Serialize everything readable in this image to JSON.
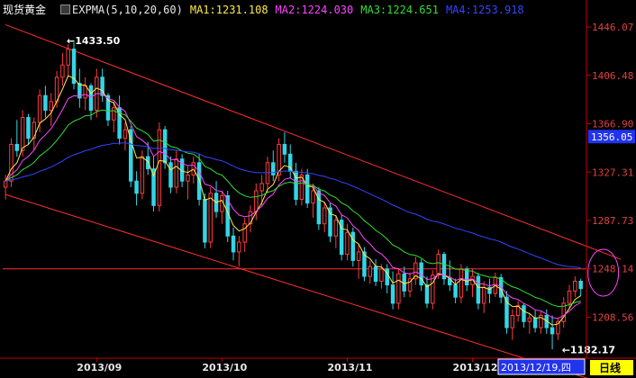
{
  "header": {
    "title": "现货黄金",
    "indicator": "EXPMA(5,10,20,60)",
    "ma1": "MA1:1231.108",
    "ma2": "MA2:1224.030",
    "ma3": "MA3:1224.651",
    "ma4": "MA4:1253.918"
  },
  "colors": {
    "up": "#ff3c3c",
    "down": "#33d6e6",
    "ma1": "#ffe94a",
    "ma2": "#ff44ff",
    "ma3": "#33dd33",
    "ma4": "#3344ff",
    "channel": "#ff3030",
    "axis": "#c00000",
    "price_label": "#e04040"
  },
  "chart_data": {
    "type": "candlestick",
    "ylim": [
      1175,
      1452
    ],
    "y_ticks": [
      "1446.07",
      "1406.48",
      "1366.90",
      "1327.31",
      "1287.73",
      "1248.14",
      "1208.56"
    ],
    "x_ticks": [
      {
        "label": "2013/09",
        "index": 16
      },
      {
        "label": "2013/10",
        "index": 38
      },
      {
        "label": "2013/11",
        "index": 60
      },
      {
        "label": "2013/12",
        "index": 82
      }
    ],
    "current_price": "1356.05",
    "horizontal_line": 1248.14,
    "high_annotation": {
      "label": "1433.50",
      "index": 12,
      "value": 1433.5
    },
    "low_annotation": {
      "label": "1182.17",
      "index": 98,
      "value": 1182.17
    },
    "cursor_date": "2013/12/19,四",
    "period_button": "日线",
    "channel_upper": [
      [
        0,
        1448
      ],
      [
        108,
        1256
      ]
    ],
    "channel_lower": [
      [
        0,
        1309
      ],
      [
        108,
        1150
      ]
    ],
    "circle_highlight": {
      "index": 104,
      "value": 1245
    },
    "candles": [
      [
        1315,
        1325,
        1305,
        1320
      ],
      [
        1320,
        1355,
        1315,
        1350
      ],
      [
        1350,
        1370,
        1340,
        1345
      ],
      [
        1345,
        1378,
        1340,
        1372
      ],
      [
        1372,
        1375,
        1350,
        1355
      ],
      [
        1355,
        1372,
        1345,
        1368
      ],
      [
        1368,
        1395,
        1360,
        1390
      ],
      [
        1390,
        1398,
        1372,
        1378
      ],
      [
        1378,
        1392,
        1365,
        1385
      ],
      [
        1385,
        1410,
        1380,
        1405
      ],
      [
        1405,
        1425,
        1398,
        1415
      ],
      [
        1415,
        1432,
        1405,
        1428
      ],
      [
        1428,
        1433.5,
        1395,
        1400
      ],
      [
        1400,
        1412,
        1380,
        1388
      ],
      [
        1388,
        1405,
        1378,
        1398
      ],
      [
        1398,
        1400,
        1370,
        1378
      ],
      [
        1378,
        1412,
        1372,
        1405
      ],
      [
        1405,
        1412,
        1385,
        1390
      ],
      [
        1390,
        1392,
        1365,
        1370
      ],
      [
        1370,
        1385,
        1360,
        1380
      ],
      [
        1380,
        1390,
        1350,
        1355
      ],
      [
        1355,
        1368,
        1345,
        1362
      ],
      [
        1362,
        1365,
        1315,
        1320
      ],
      [
        1320,
        1328,
        1300,
        1310
      ],
      [
        1310,
        1345,
        1305,
        1340
      ],
      [
        1340,
        1352,
        1325,
        1330
      ],
      [
        1330,
        1340,
        1295,
        1300
      ],
      [
        1300,
        1368,
        1295,
        1362
      ],
      [
        1362,
        1365,
        1330,
        1335
      ],
      [
        1335,
        1340,
        1310,
        1315
      ],
      [
        1315,
        1345,
        1310,
        1338
      ],
      [
        1338,
        1342,
        1315,
        1320
      ],
      [
        1320,
        1332,
        1305,
        1325
      ],
      [
        1325,
        1340,
        1318,
        1335
      ],
      [
        1335,
        1342,
        1300,
        1305
      ],
      [
        1305,
        1310,
        1265,
        1270
      ],
      [
        1270,
        1315,
        1265,
        1310
      ],
      [
        1310,
        1320,
        1290,
        1295
      ],
      [
        1295,
        1312,
        1285,
        1308
      ],
      [
        1308,
        1312,
        1270,
        1275
      ],
      [
        1275,
        1282,
        1255,
        1262
      ],
      [
        1262,
        1275,
        1250,
        1270
      ],
      [
        1270,
        1290,
        1262,
        1285
      ],
      [
        1285,
        1300,
        1278,
        1295
      ],
      [
        1295,
        1318,
        1288,
        1312
      ],
      [
        1312,
        1325,
        1300,
        1318
      ],
      [
        1318,
        1340,
        1310,
        1335
      ],
      [
        1335,
        1345,
        1320,
        1325
      ],
      [
        1325,
        1355,
        1320,
        1350
      ],
      [
        1350,
        1360,
        1335,
        1342
      ],
      [
        1342,
        1350,
        1322,
        1328
      ],
      [
        1328,
        1335,
        1300,
        1305
      ],
      [
        1305,
        1330,
        1300,
        1325
      ],
      [
        1325,
        1330,
        1298,
        1302
      ],
      [
        1302,
        1318,
        1290,
        1312
      ],
      [
        1312,
        1315,
        1280,
        1285
      ],
      [
        1285,
        1302,
        1278,
        1298
      ],
      [
        1298,
        1302,
        1270,
        1275
      ],
      [
        1275,
        1292,
        1265,
        1288
      ],
      [
        1288,
        1292,
        1255,
        1260
      ],
      [
        1260,
        1285,
        1255,
        1278
      ],
      [
        1278,
        1282,
        1250,
        1255
      ],
      [
        1255,
        1268,
        1240,
        1262
      ],
      [
        1262,
        1266,
        1238,
        1242
      ],
      [
        1242,
        1255,
        1236,
        1250
      ],
      [
        1250,
        1256,
        1234,
        1238
      ],
      [
        1238,
        1252,
        1232,
        1248
      ],
      [
        1248,
        1252,
        1228,
        1235
      ],
      [
        1235,
        1246,
        1215,
        1220
      ],
      [
        1220,
        1248,
        1215,
        1244
      ],
      [
        1244,
        1250,
        1225,
        1230
      ],
      [
        1230,
        1245,
        1225,
        1240
      ],
      [
        1240,
        1258,
        1235,
        1253
      ],
      [
        1253,
        1256,
        1230,
        1235
      ],
      [
        1235,
        1242,
        1216,
        1220
      ],
      [
        1220,
        1247,
        1215,
        1243
      ],
      [
        1243,
        1264,
        1240,
        1260
      ],
      [
        1260,
        1262,
        1235,
        1240
      ],
      [
        1240,
        1255,
        1230,
        1235
      ],
      [
        1235,
        1240,
        1220,
        1225
      ],
      [
        1225,
        1252,
        1220,
        1248
      ],
      [
        1248,
        1250,
        1230,
        1235
      ],
      [
        1235,
        1248,
        1225,
        1242
      ],
      [
        1242,
        1245,
        1215,
        1220
      ],
      [
        1220,
        1238,
        1212,
        1233
      ],
      [
        1233,
        1240,
        1220,
        1228
      ],
      [
        1228,
        1245,
        1225,
        1241
      ],
      [
        1241,
        1244,
        1220,
        1225
      ],
      [
        1225,
        1230,
        1195,
        1200
      ],
      [
        1200,
        1215,
        1190,
        1210
      ],
      [
        1210,
        1222,
        1205,
        1218
      ],
      [
        1218,
        1220,
        1200,
        1205
      ],
      [
        1205,
        1212,
        1195,
        1208
      ],
      [
        1208,
        1214,
        1196,
        1200
      ],
      [
        1200,
        1213,
        1195,
        1210
      ],
      [
        1210,
        1215,
        1195,
        1200
      ],
      [
        1200,
        1210,
        1182.17,
        1195
      ],
      [
        1195,
        1208,
        1190,
        1205
      ],
      [
        1205,
        1225,
        1200,
        1220
      ],
      [
        1220,
        1235,
        1215,
        1230
      ],
      [
        1230,
        1242,
        1225,
        1238
      ],
      [
        1238,
        1240,
        1226,
        1232
      ]
    ],
    "series": [
      {
        "period": 5
      },
      {
        "period": 10
      },
      {
        "period": 20
      },
      {
        "period": 60
      }
    ]
  }
}
